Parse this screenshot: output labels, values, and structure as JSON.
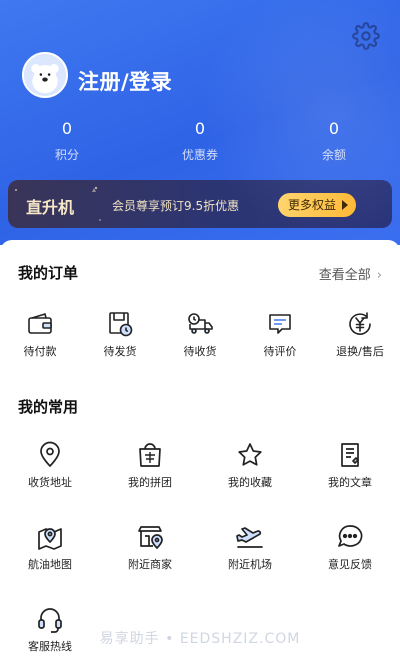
{
  "header": {
    "login_label": "注册/登录",
    "settings_icon": "gear-icon",
    "avatar_icon": "polar-bear-avatar",
    "colors": {
      "gradient_start": "#3f78f0",
      "gradient_end": "#2f63e6"
    }
  },
  "stats": [
    {
      "value": "0",
      "label": "积分"
    },
    {
      "value": "0",
      "label": "优惠券"
    },
    {
      "value": "0",
      "label": "余额"
    }
  ],
  "banner": {
    "title": "直升机",
    "subtitle": "会员尊享预订9.5折优惠",
    "button_label": "更多权益",
    "colors": {
      "bg": "#2c3573",
      "button": "#ffc24a"
    }
  },
  "orders": {
    "title": "我的订单",
    "view_all_label": "查看全部",
    "items": [
      {
        "label": "待付款",
        "icon": "wallet-icon"
      },
      {
        "label": "待发货",
        "icon": "package-clock-icon"
      },
      {
        "label": "待收货",
        "icon": "delivery-truck-icon"
      },
      {
        "label": "待评价",
        "icon": "comment-icon"
      },
      {
        "label": "退换/售后",
        "icon": "yen-refund-icon"
      }
    ]
  },
  "common": {
    "title": "我的常用",
    "items": [
      {
        "label": "收货地址",
        "icon": "location-pin-icon"
      },
      {
        "label": "我的拼团",
        "icon": "group-buy-bag-icon"
      },
      {
        "label": "我的收藏",
        "icon": "star-icon"
      },
      {
        "label": "我的文章",
        "icon": "article-icon"
      },
      {
        "label": "航油地图",
        "icon": "map-pin-icon"
      },
      {
        "label": "附近商家",
        "icon": "nearby-shop-icon"
      },
      {
        "label": "附近机场",
        "icon": "airplane-takeoff-icon"
      },
      {
        "label": "意见反馈",
        "icon": "feedback-chat-icon"
      },
      {
        "label": "客服热线",
        "icon": "headset-icon"
      }
    ]
  },
  "watermark": "易享助手 • EEDSHZIZ.COM"
}
